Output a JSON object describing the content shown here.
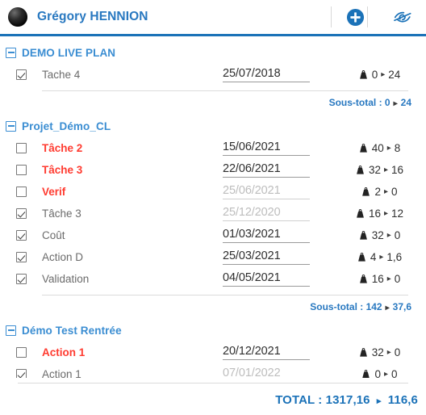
{
  "header": {
    "user_name": "Grégory HENNION",
    "avatar_name": "user-avatar",
    "add_button_label": "+",
    "add_icon": "plus-circle-icon",
    "hide_icon": "eye-slash-icon",
    "accent_color": "#1b72b8",
    "link_color": "#2878c0"
  },
  "groups": [
    {
      "title": "DEMO LIVE PLAN",
      "collapse_icon": "minus-square-icon",
      "rows": [
        {
          "checked": true,
          "name": "Tache 4",
          "late": false,
          "date": "25/07/2018",
          "date_muted": false,
          "weight_from": "0",
          "weight_to": "24"
        }
      ],
      "subtotal_label": "Sous-total :",
      "subtotal_from": "0",
      "subtotal_to": "24",
      "subtotal_text": "Sous-total : 0 ▸ 24"
    },
    {
      "title": "Projet_Démo_CL",
      "collapse_icon": "minus-square-icon",
      "rows": [
        {
          "checked": false,
          "name": "Tâche 2",
          "late": true,
          "date": "15/06/2021",
          "date_muted": false,
          "weight_from": "40",
          "weight_to": "8"
        },
        {
          "checked": false,
          "name": "Tâche 3",
          "late": true,
          "date": "22/06/2021",
          "date_muted": false,
          "weight_from": "32",
          "weight_to": "16"
        },
        {
          "checked": false,
          "name": "Verif",
          "late": true,
          "date": "25/06/2021",
          "date_muted": true,
          "weight_from": "2",
          "weight_to": "0"
        },
        {
          "checked": true,
          "name": "Tâche 3",
          "late": false,
          "date": "25/12/2020",
          "date_muted": true,
          "weight_from": "16",
          "weight_to": "12"
        },
        {
          "checked": true,
          "name": "Coût",
          "late": false,
          "date": "01/03/2021",
          "date_muted": false,
          "weight_from": "32",
          "weight_to": "0"
        },
        {
          "checked": true,
          "name": "Action D",
          "late": false,
          "date": "25/03/2021",
          "date_muted": false,
          "weight_from": "4",
          "weight_to": "1,6"
        },
        {
          "checked": true,
          "name": "Validation",
          "late": false,
          "date": "04/05/2021",
          "date_muted": false,
          "weight_from": "16",
          "weight_to": "0"
        }
      ],
      "subtotal_label": "Sous-total :",
      "subtotal_from": "142",
      "subtotal_to": "37,6",
      "subtotal_text": "Sous-total : 142 ▸ 37,6"
    },
    {
      "title": "Démo Test Rentrée",
      "collapse_icon": "minus-square-icon",
      "rows": [
        {
          "checked": false,
          "name": "Action 1",
          "late": true,
          "date": "20/12/2021",
          "date_muted": false,
          "weight_from": "32",
          "weight_to": "0"
        },
        {
          "checked": true,
          "name": "Action 1",
          "late": false,
          "date": "07/01/2022",
          "date_muted": true,
          "weight_from": "0",
          "weight_to": "0"
        }
      ],
      "subtotal_text": null
    }
  ],
  "footer": {
    "total_label": "TOTAL :",
    "total_from": "1317,16",
    "total_to": "116,6",
    "total_text": "TOTAL : 1317,16 ▸ 116,6"
  },
  "icons": {
    "weight_icon": "weight-icon",
    "arrow_glyph": "▸"
  }
}
